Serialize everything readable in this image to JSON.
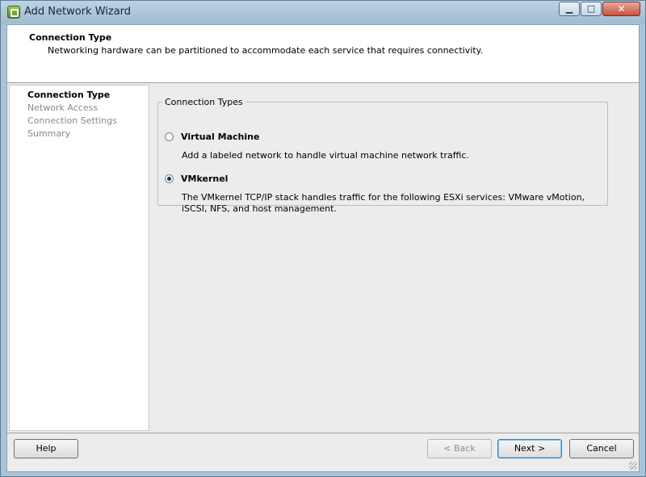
{
  "window": {
    "title": "Add Network Wizard",
    "controls": {
      "minimize": "▁",
      "maximize": "□",
      "close": "✕"
    }
  },
  "header": {
    "title": "Connection Type",
    "subtitle": "Networking hardware can be partitioned to accommodate each service that requires connectivity."
  },
  "steps": [
    {
      "label": "Connection Type",
      "active": true
    },
    {
      "label": "Network Access",
      "active": false
    },
    {
      "label": "Connection Settings",
      "active": false
    },
    {
      "label": "Summary",
      "active": false
    }
  ],
  "connection_types": {
    "legend": "Connection Types",
    "options": [
      {
        "label": "Virtual Machine",
        "description": "Add a labeled network to handle virtual machine network traffic.",
        "selected": false
      },
      {
        "label": "VMkernel",
        "description": "The VMkernel TCP/IP stack handles traffic for the following ESXi services: VMware vMotion, iSCSI, NFS, and host management.",
        "selected": true
      }
    ]
  },
  "buttons": {
    "help": "Help",
    "back": "< Back",
    "next": "Next >",
    "cancel": "Cancel"
  },
  "icons": {
    "app": "vsphere-network-icon",
    "minimize": "minimize-icon",
    "maximize": "maximize-icon",
    "close": "close-icon",
    "resize": "resize-grip-icon"
  },
  "colors": {
    "title_bar": "#a9c4d8",
    "client_bg": "#ececec",
    "close_button": "#c8523d"
  }
}
